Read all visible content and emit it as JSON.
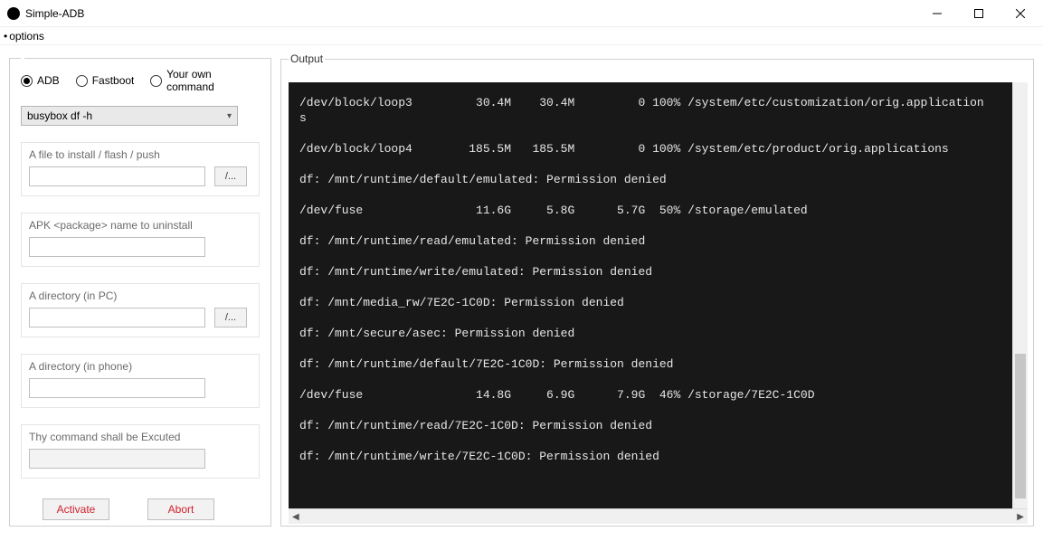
{
  "window": {
    "title": "Simple-ADB"
  },
  "menu": {
    "options": "options"
  },
  "mode": {
    "adb": "ADB",
    "fastboot": "Fastboot",
    "own": "Your own command",
    "selected": "adb"
  },
  "command_select": {
    "value": "busybox df -h"
  },
  "groups": {
    "install": {
      "label": "A file to install / flash / push",
      "browse": "/..."
    },
    "uninstall": {
      "label": "APK <package> name to uninstall"
    },
    "dir_pc": {
      "label": "A directory (in PC)",
      "browse": "/..."
    },
    "dir_phone": {
      "label": "A directory (in phone)"
    },
    "command": {
      "label": "Thy command shall be Excuted"
    }
  },
  "buttons": {
    "activate": "Activate",
    "abort": "Abort"
  },
  "output": {
    "legend": "Output",
    "lines": [
      "/dev/block/loop3         30.4M    30.4M         0 100% /system/etc/customization/orig.application",
      "s",
      "",
      "/dev/block/loop4        185.5M   185.5M         0 100% /system/etc/product/orig.applications",
      "",
      "df: /mnt/runtime/default/emulated: Permission denied",
      "",
      "/dev/fuse                11.6G     5.8G      5.7G  50% /storage/emulated",
      "",
      "df: /mnt/runtime/read/emulated: Permission denied",
      "",
      "df: /mnt/runtime/write/emulated: Permission denied",
      "",
      "df: /mnt/media_rw/7E2C-1C0D: Permission denied",
      "",
      "df: /mnt/secure/asec: Permission denied",
      "",
      "df: /mnt/runtime/default/7E2C-1C0D: Permission denied",
      "",
      "/dev/fuse                14.8G     6.9G      7.9G  46% /storage/7E2C-1C0D",
      "",
      "df: /mnt/runtime/read/7E2C-1C0D: Permission denied",
      "",
      "df: /mnt/runtime/write/7E2C-1C0D: Permission denied"
    ]
  }
}
